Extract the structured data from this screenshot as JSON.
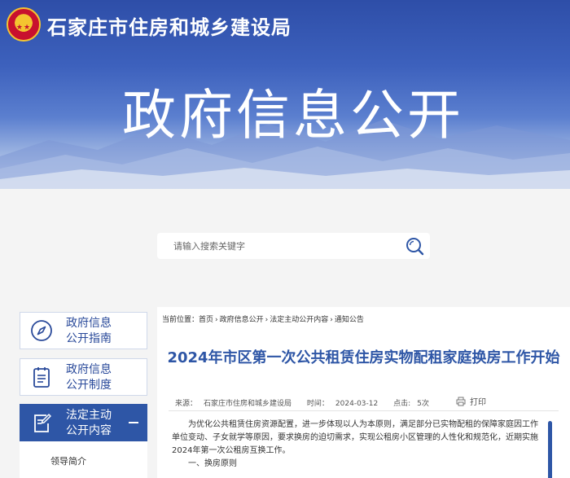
{
  "header": {
    "bureau_name": "石家庄市住房和城乡建设局",
    "banner_title": "政府信息公开"
  },
  "search": {
    "placeholder": "请输入搜索关键字",
    "icon": "search-icon"
  },
  "sidebar": {
    "items": [
      {
        "label_line1": "政府信息",
        "label_line2": "公开指南",
        "icon": "compass-icon",
        "active": false
      },
      {
        "label_line1": "政府信息",
        "label_line2": "公开制度",
        "icon": "document-list-icon",
        "active": false
      },
      {
        "label_line1": "法定主动",
        "label_line2": "公开内容",
        "icon": "document-edit-icon",
        "active": true
      }
    ],
    "sub_items": [
      "领导简介"
    ]
  },
  "breadcrumb": {
    "prefix": "当前位置：",
    "items": [
      "首页",
      "政府信息公开",
      "法定主动公开内容",
      "通知公告"
    ],
    "separator": "›"
  },
  "article": {
    "title": "2024年市区第一次公共租赁住房实物配租家庭换房工作开始",
    "source_label": "来源：",
    "source": "石家庄市住房和城乡建设局",
    "time_label": "时间：",
    "time": "2024-03-12",
    "clicks_label": "点击:",
    "clicks": "5次",
    "print_label": "打印",
    "paragraph1": "为优化公共租赁住房资源配置，进一步体现以人为本原则，满足部分已实物配租的保障家庭因工作单位变动、子女就学等原因，要求换房的迫切需求，实现公租房小区管理的人性化和规范化，近期实施2024年第一次公租房互换工作。",
    "section1": "一、换房原则"
  },
  "colors": {
    "accent": "#2e56a6",
    "banner_top": "#2e4ea8"
  }
}
